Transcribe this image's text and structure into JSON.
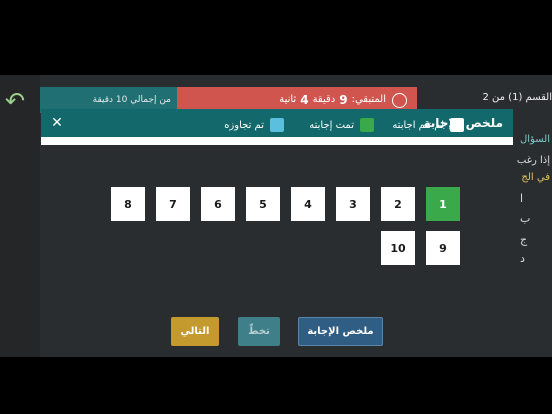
{
  "topbar": {
    "total_label": "من إجمالي 10 دقيقة",
    "remaining_label": "المتبقي:",
    "minutes_value": "9",
    "minutes_unit": "دقيقة",
    "seconds_value": "4",
    "seconds_unit": "ثانية",
    "section_label": "القسم (1) من 2"
  },
  "background_question": {
    "heading": "السؤال",
    "line1": "إذا رغب",
    "line2": "في الج",
    "options": [
      "ا",
      "ب",
      "ج",
      "د"
    ]
  },
  "modal": {
    "title": "ملخص الإجابة",
    "close_glyph": "✕",
    "legend": [
      {
        "label": "لم تتم اجابته",
        "color": "#ffffff"
      },
      {
        "label": "تمت إجابته",
        "color": "#3aa94a"
      },
      {
        "label": "تم تجاوزه",
        "color": "#5bc0de"
      }
    ],
    "questions": [
      {
        "number": "1",
        "status": "answered"
      },
      {
        "number": "2",
        "status": "unanswered"
      },
      {
        "number": "3",
        "status": "unanswered"
      },
      {
        "number": "4",
        "status": "unanswered"
      },
      {
        "number": "5",
        "status": "unanswered"
      },
      {
        "number": "6",
        "status": "unanswered"
      },
      {
        "number": "7",
        "status": "unanswered"
      },
      {
        "number": "8",
        "status": "unanswered"
      },
      {
        "number": "9",
        "status": "unanswered"
      },
      {
        "number": "10",
        "status": "unanswered"
      }
    ]
  },
  "buttons": {
    "next_label": "التالي",
    "skip_label": "تخطّ",
    "summary_label": "ملخص الإجابة"
  }
}
